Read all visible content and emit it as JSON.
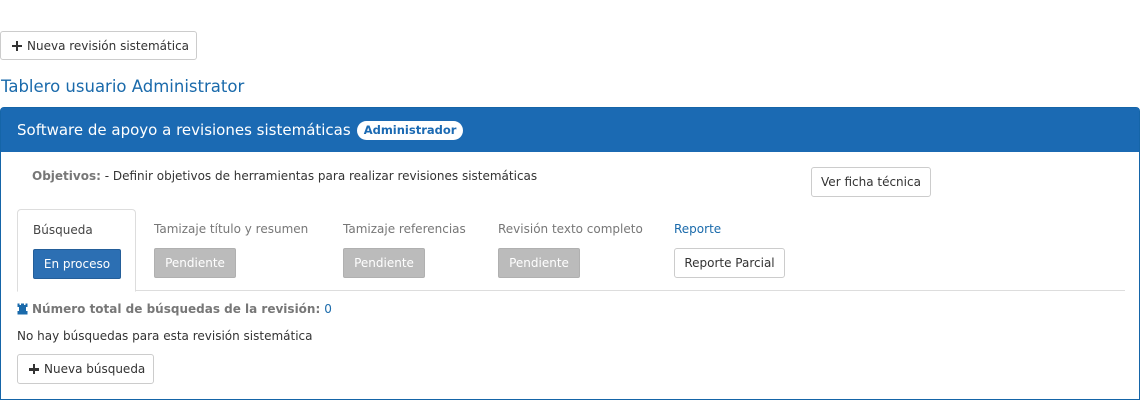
{
  "toolbar": {
    "new_review_label": "Nueva revisión sistemática"
  },
  "dashboard": {
    "title": "Tablero usuario Administrator"
  },
  "panel": {
    "title": "Software de apoyo a revisiones sistemáticas",
    "role_badge": "Administrador",
    "objectives_label": "Objetivos:",
    "objectives_text": "- Definir objetivos de herramientas para realizar revisiones sistemáticas",
    "tech_sheet_label": "Ver ficha técnica"
  },
  "tabs": [
    {
      "label": "Búsqueda",
      "status": "En proceso"
    },
    {
      "label": "Tamizaje título y resumen",
      "status": "Pendiente"
    },
    {
      "label": "Tamizaje referencias",
      "status": "Pendiente"
    },
    {
      "label": "Revisión texto completo",
      "status": "Pendiente"
    },
    {
      "label": "Reporte",
      "action": "Reporte Parcial"
    }
  ],
  "search": {
    "count_label": "Número total de búsquedas de la revisión:",
    "count_value": "0",
    "empty_message": "No hay búsquedas para esta revisión sistemática",
    "new_search_label": "Nueva búsqueda"
  },
  "colors": {
    "primary": "#1b6ab3",
    "link": "#1a6aab",
    "status_active": "#2c6fb3",
    "status_pending": "#bbbbbb"
  },
  "icons": {
    "add": "plus-icon",
    "search_count": "rook-icon"
  }
}
